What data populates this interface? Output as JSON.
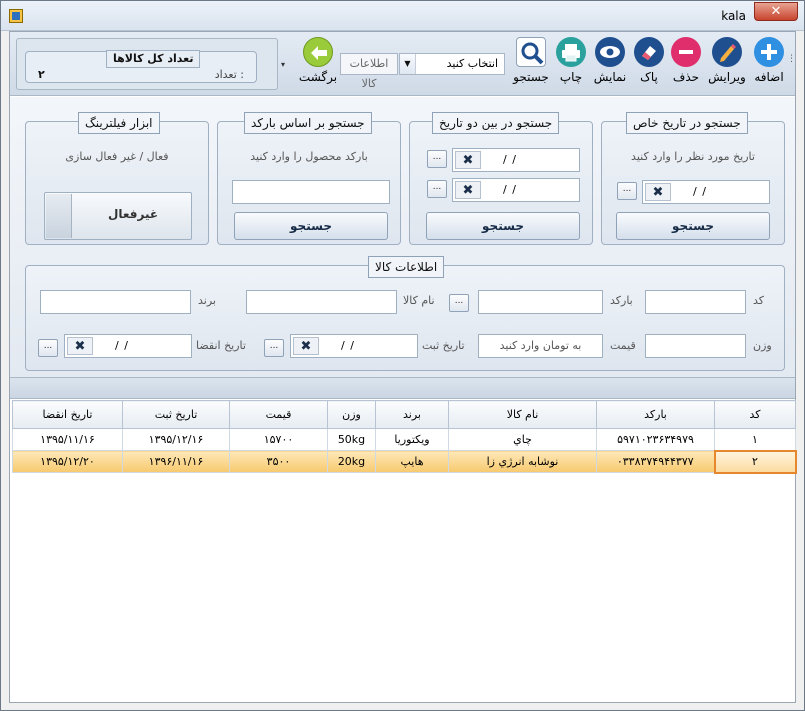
{
  "window": {
    "title": "kala",
    "close_glyph": "✕"
  },
  "toolbar": {
    "count_group_title": "تعداد کل کالاها",
    "count_label": "تعداد :",
    "count_value": "۲",
    "buttons": [
      {
        "id": "add",
        "label": "اضافه",
        "icon": "plus-icon",
        "color": "#2f8fe0"
      },
      {
        "id": "edit",
        "label": "ویرایش",
        "icon": "pencil-icon",
        "color": "#1f4f8f"
      },
      {
        "id": "delete",
        "label": "حذف",
        "icon": "minus-icon",
        "color": "#e02d6b"
      },
      {
        "id": "clear",
        "label": "پاک",
        "icon": "eraser-icon",
        "color": "#1f4f8f"
      },
      {
        "id": "show",
        "label": "نمایش",
        "icon": "eye-icon",
        "color": "#1f4f8f"
      },
      {
        "id": "print",
        "label": "چاپ",
        "icon": "printer-icon",
        "color": "#2aa19c"
      },
      {
        "id": "search",
        "label": "جستجو",
        "icon": "magnifier-icon",
        "color": "#1f4f8f"
      }
    ],
    "select_value": "انتخاب کنید",
    "info_button": "اطلاعات کالا",
    "back_label": "برگشت",
    "back_icon": "arrow-left-icon",
    "back_color": "#9acb3a"
  },
  "groups": {
    "filter": {
      "title": "ابزار فیلترینگ",
      "hint": "فعال / غیر فعال سازی",
      "toggle_label": "غیرفعال"
    },
    "barcode": {
      "title": "جستجو بر اساس بارکد",
      "hint": "بارکد محصول را وارد کنید",
      "button": "جستجو"
    },
    "between": {
      "title": "جستجو در بین دو تاریخ",
      "date1": "/ /",
      "date2": "/ /",
      "button": "جستجو"
    },
    "specific": {
      "title": "جستجو در تاریخ خاص",
      "hint": "تاریخ مورد نظر را وارد کنید",
      "date": "/ /",
      "button": "جستجو"
    }
  },
  "info": {
    "title": "اطلاعات کالا",
    "labels": {
      "code": "کد",
      "barcode": "بارکد",
      "name": "نام کالا",
      "brand": "برند",
      "weight": "وزن",
      "price": "قیمت",
      "reg_date": "تاریخ ثبت",
      "exp_date": "تاریخ انقضا"
    },
    "price_placeholder": "به تومان وارد کنید",
    "reg_date": "/ /",
    "exp_date": "/ /"
  },
  "grid": {
    "columns": [
      "کد",
      "بارکد",
      "نام کالا",
      "برند",
      "وزن",
      "قیمت",
      "تاریخ ثبت",
      "تاریخ انقضا"
    ],
    "rows": [
      [
        "۱",
        "۵۹۷۱۰۲۳۶۳۴۹۷۹",
        "چاي",
        "ويکتوريا",
        "50kg",
        "۱۵۷۰۰",
        "۱۳۹۵/۱۲/۱۶",
        "۱۳۹۵/۱۱/۱۶"
      ],
      [
        "۲",
        "۰۳۳۸۳۷۴۹۴۴۳۷۷",
        "نوشابه انرژي زا",
        "هايپ",
        "20kg",
        "۳۵۰۰",
        "۱۳۹۶/۱۱/۱۶",
        "۱۳۹۵/۱۲/۲۰"
      ]
    ],
    "selected_row": 1
  }
}
